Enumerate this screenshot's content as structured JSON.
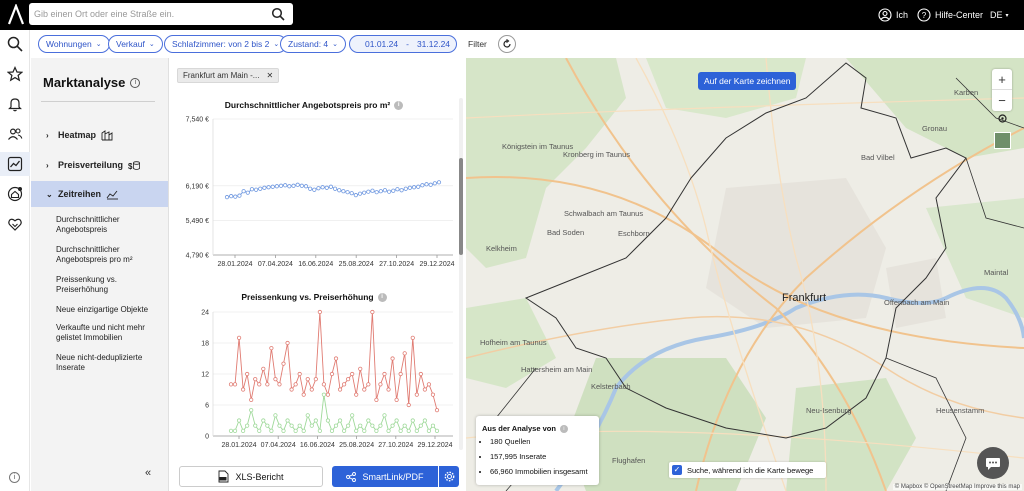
{
  "topbar": {
    "search_placeholder": "Gib einen Ort oder eine Straße ein.",
    "user_label": "Ich",
    "help_label": "Hilfe-Center",
    "language": "DE"
  },
  "filters": {
    "chips": [
      "Wohnungen",
      "Verkauf",
      "Schlafzimmer: von 2 bis 2",
      "Zustand: 4"
    ],
    "date_from": "01.01.24",
    "date_sep": "-",
    "date_to": "31.12.24",
    "filter_label": "Filter"
  },
  "nav": {
    "title": "Marktanalyse",
    "items": [
      {
        "label": "Heatmap"
      },
      {
        "label": "Preisverteilung"
      },
      {
        "label": "Zeitreihen"
      }
    ],
    "subitems": [
      "Durchschnittlicher Angebotspreis",
      "Durchschnittlicher Angebotspreis pro m²",
      "Preissenkung vs. Preiserhöhung",
      "Neue einzigartige Objekte",
      "Verkaufte und nicht mehr gelistet Immobilien",
      "Neue nicht-deduplizierte Inserate"
    ]
  },
  "location_chip": "Frankfurt am Main -...",
  "chart_data": [
    {
      "type": "line",
      "title": "Durchschnittlicher Angebotspreis pro m²",
      "yticks": [
        "7,540 €",
        "6,190 €",
        "5,490 €",
        "4,790 €"
      ],
      "ylim": [
        4790,
        7540
      ],
      "xticks": [
        "28.01.2024",
        "07.04.2024",
        "16.06.2024",
        "25.08.2024",
        "27.10.2024",
        "29.12.2024"
      ],
      "series": [
        {
          "color": "#6f98e0",
          "values": [
            5960,
            5980,
            5970,
            5990,
            6080,
            6050,
            6120,
            6110,
            6130,
            6150,
            6160,
            6170,
            6180,
            6190,
            6200,
            6180,
            6190,
            6210,
            6190,
            6180,
            6130,
            6110,
            6140,
            6160,
            6150,
            6170,
            6130,
            6100,
            6080,
            6060,
            6040,
            6000,
            6030,
            6050,
            6070,
            6090,
            6060,
            6080,
            6100,
            6070,
            6090,
            6120,
            6100,
            6130,
            6150,
            6160,
            6170,
            6200,
            6220,
            6210,
            6240,
            6260
          ]
        }
      ]
    },
    {
      "type": "line",
      "title": "Preissenkung vs. Preiserhöhung",
      "yticks": [
        "24",
        "18",
        "12",
        "6",
        "0"
      ],
      "ylim": [
        0,
        24
      ],
      "xticks": [
        "28.01.2024",
        "07.04.2024",
        "16.06.2024",
        "25.08.2024",
        "27.10.2024",
        "29.12.2024"
      ],
      "series": [
        {
          "color": "#e07b72",
          "values": [
            10,
            10,
            19,
            9,
            12,
            7,
            11,
            10,
            13,
            10,
            17,
            11,
            10,
            14,
            18,
            9,
            10,
            12,
            8,
            11,
            9,
            11,
            24,
            10,
            8,
            12,
            15,
            9,
            10,
            11,
            12,
            8,
            13,
            9,
            10,
            24,
            7,
            10,
            12,
            9,
            15,
            7,
            12,
            16,
            6,
            19,
            8,
            12,
            9,
            10,
            8,
            5
          ]
        },
        {
          "color": "#9fd99a",
          "values": [
            1,
            1,
            3,
            1,
            2,
            5,
            2,
            1,
            3,
            2,
            1,
            4,
            2,
            1,
            3,
            2,
            1,
            2,
            1,
            4,
            2,
            3,
            1,
            8,
            3,
            1,
            2,
            3,
            1,
            2,
            4,
            1,
            2,
            1,
            3,
            2,
            1,
            2,
            4,
            1,
            2,
            3,
            1,
            2,
            1,
            3,
            1,
            2,
            3,
            1,
            2,
            1
          ]
        }
      ]
    }
  ],
  "buttons": {
    "xls": "XLS-Bericht",
    "smartlink": "SmartLink/PDF"
  },
  "map": {
    "draw_button": "Auf der Karte zeichnen",
    "places": [
      {
        "name": "Königstein im Taunus"
      },
      {
        "name": "Kronberg im Taunus"
      },
      {
        "name": "Bad Soden"
      },
      {
        "name": "Schwalbach am Taunus"
      },
      {
        "name": "Eschborn"
      },
      {
        "name": "Kelkheim"
      },
      {
        "name": "Hofheim am Taunus"
      },
      {
        "name": "Hattersheim am Main"
      },
      {
        "name": "Frankfurt"
      },
      {
        "name": "Offenbach am Main"
      },
      {
        "name": "Neu-Isenburg"
      },
      {
        "name": "Heusenstamm"
      },
      {
        "name": "Bad Vilbel"
      },
      {
        "name": "Kelsterbach"
      },
      {
        "name": "Flughafen"
      },
      {
        "name": "Karben"
      },
      {
        "name": "Maintal"
      },
      {
        "name": "Gronau"
      }
    ],
    "analysis_title": "Aus der Analyse von",
    "analysis_items": [
      "180 Quellen",
      "157,995 Inserate",
      "66,960 Immobilien insgesamt"
    ],
    "search_move_label": "Suche, während ich die Karte bewege",
    "attribution": "© Mapbox © OpenStreetMap  Improve this map"
  },
  "colors": {
    "accent": "#2d62d8",
    "nav_active": "#c9d5f0",
    "chip_border": "#4a6fdc"
  }
}
